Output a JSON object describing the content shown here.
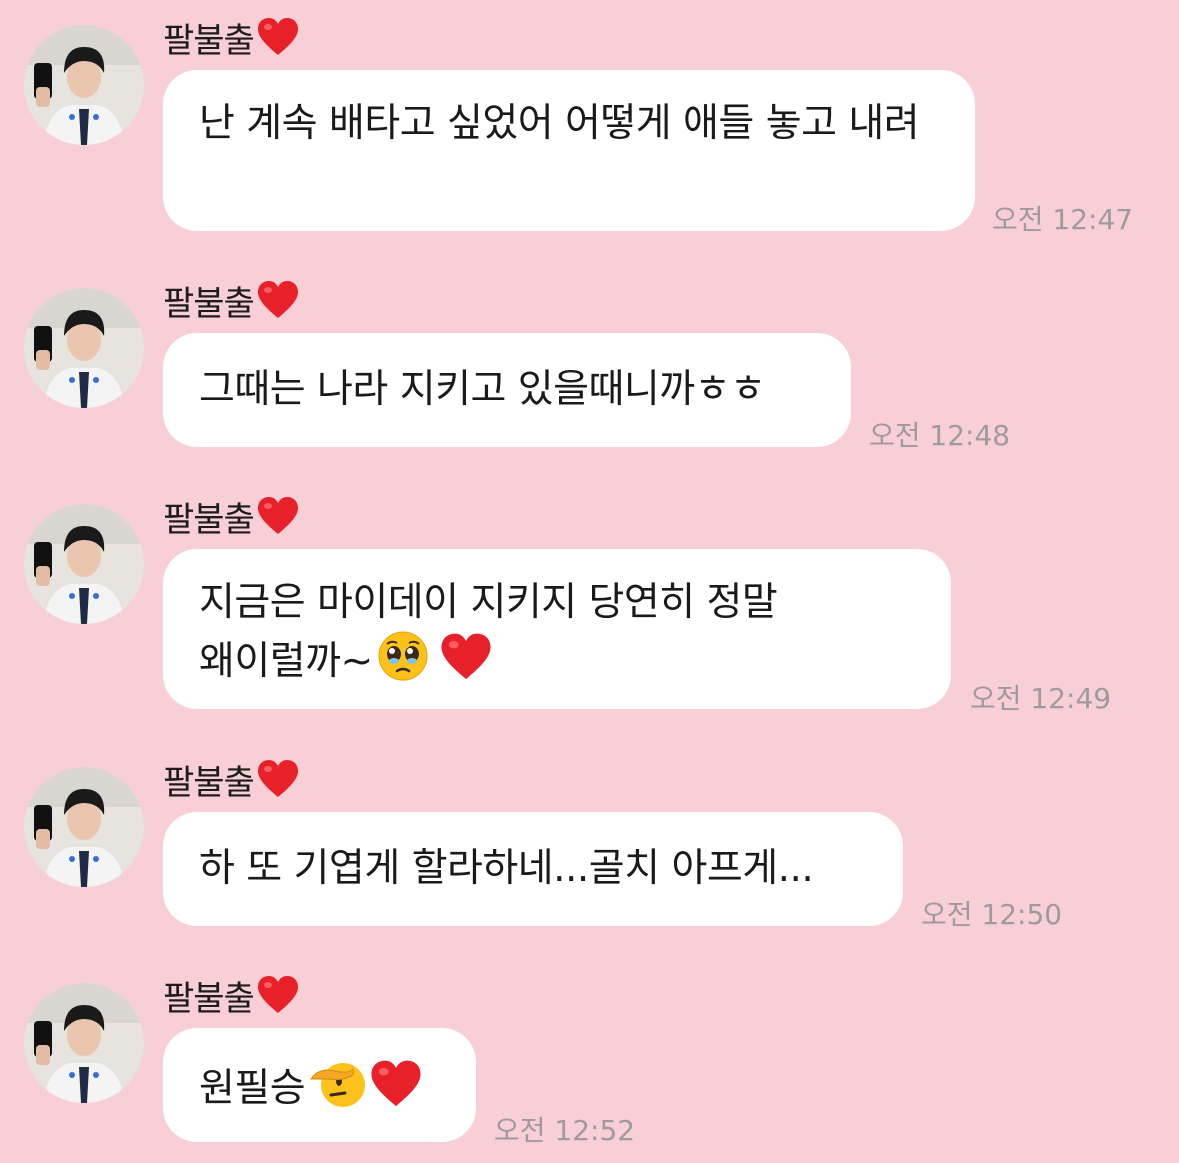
{
  "messages": [
    {
      "sender": "팔불출",
      "sender_icon": "heart-icon",
      "text": "난 계속 배타고 싶었어 어떻게 애들 놓고 내려",
      "time": "오전 12:47",
      "emojis": []
    },
    {
      "sender": "팔불출",
      "sender_icon": "heart-icon",
      "text": "그때는 나라 지키고 있을때니까ㅎㅎ",
      "time": "오전 12:48",
      "emojis": []
    },
    {
      "sender": "팔불출",
      "sender_icon": "heart-icon",
      "text": "지금은 마이데이 지키지 당연히 정말 왜이럴까~",
      "time": "오전 12:49",
      "emojis": [
        "pleading-face-emoji",
        "red-heart-emoji"
      ]
    },
    {
      "sender": "팔불출",
      "sender_icon": "heart-icon",
      "text": "하 또 기엽게 할라하네...골치 아프게...",
      "time": "오전 12:50",
      "emojis": []
    },
    {
      "sender": "팔불출",
      "sender_icon": "heart-icon",
      "text": "원필승",
      "time": "오전 12:52",
      "emojis": [
        "saluting-face-emoji",
        "red-heart-emoji"
      ]
    }
  ],
  "colors": {
    "background": "#f8cfd7",
    "bubble": "#ffffff",
    "timestamp": "#9f9a9c",
    "heart": "#e8202a"
  }
}
